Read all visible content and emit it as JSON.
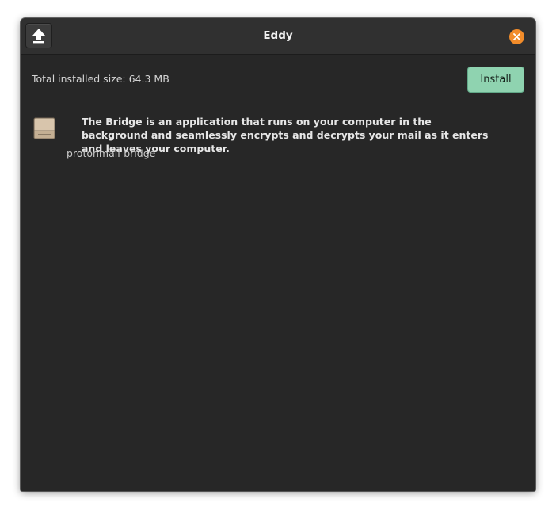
{
  "window": {
    "title": "Eddy"
  },
  "header": {
    "total_size_label": "Total installed size: 64.3 MB",
    "install_label": "Install"
  },
  "package": {
    "description": "The Bridge is an application that runs on your computer in the background and seamlessly encrypts and decrypts your mail as it enters and leaves your computer.",
    "name": "protonmail-bridge",
    "icon": "package-box-icon"
  },
  "colors": {
    "window_bg": "#272727",
    "titlebar_bg": "#303030",
    "install_accent": "#8fd3b0",
    "close_accent": "#f28c2a"
  }
}
